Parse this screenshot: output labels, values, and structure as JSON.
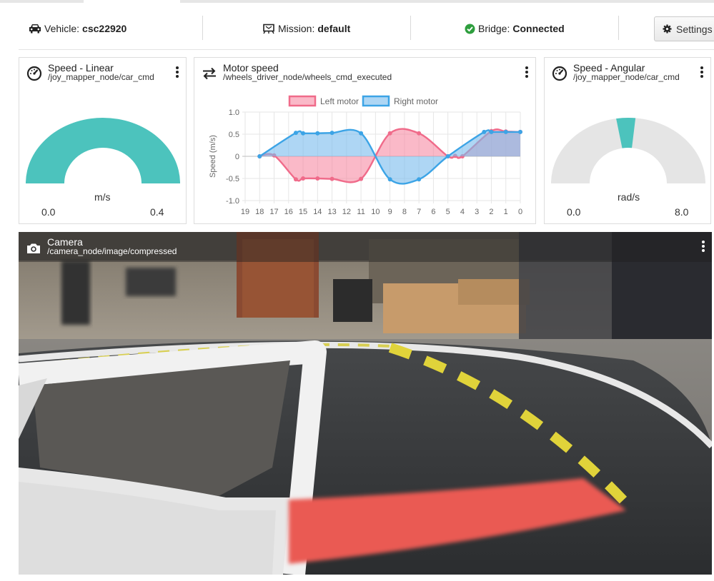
{
  "status": {
    "vehicle_label": "Vehicle:",
    "vehicle_value": "csc22920",
    "mission_label": "Mission:",
    "mission_value": "default",
    "bridge_label": "Bridge:",
    "bridge_value": "Connected",
    "settings_label": "Settings",
    "colors": {
      "connected": "#2e9e3e"
    }
  },
  "panels": {
    "linear": {
      "title": "Speed - Linear",
      "topic": "/joy_mapper_node/car_cmd",
      "icon": "speedometer-icon",
      "unit": "m/s",
      "min": "0.0",
      "max": "0.4",
      "level": 1.0,
      "color": "#4cc3bd"
    },
    "motor": {
      "title": "Motor speed",
      "topic": "/wheels_driver_node/wheels_cmd_executed",
      "icon": "swap-arrows-icon"
    },
    "angular": {
      "title": "Speed - Angular",
      "topic": "/joy_mapper_node/car_cmd",
      "icon": "speedometer-icon",
      "unit": "rad/s",
      "min": "0.0",
      "max": "8.0",
      "value_fraction_start": 0.45,
      "value_fraction_end": 0.53,
      "color": "#4cc3bd",
      "track_color": "#e5e5e5"
    },
    "camera": {
      "title": "Camera",
      "topic": "/camera_node/image/compressed",
      "icon": "camera-icon"
    }
  },
  "chart_data": {
    "type": "line",
    "ylabel": "Speed (m/s)",
    "xlabel": "",
    "ylim": [
      -1.0,
      1.0
    ],
    "yticks": [
      "1.0",
      "0.5",
      "0",
      "-0.5",
      "-1.0"
    ],
    "x": [
      19,
      18,
      17,
      16,
      15,
      14,
      13,
      12,
      11,
      10,
      9,
      8,
      7,
      6,
      5,
      4,
      3,
      2,
      1,
      0
    ],
    "grid": true,
    "legend_position": "top",
    "series": [
      {
        "name": "Left motor",
        "color": "#f06b8a",
        "fill": "rgba(246,128,155,0.55)",
        "values": [
          null,
          0.0,
          0.02,
          null,
          -0.52,
          -0.5,
          -0.51,
          null,
          -0.52,
          null,
          0.52,
          null,
          0.52,
          null,
          0.0,
          0.0,
          null,
          0.57,
          0.56,
          0.55
        ],
        "points": [
          [
            18,
            0.0
          ],
          [
            17,
            0.02
          ],
          [
            15.5,
            -0.52
          ],
          [
            15,
            -0.5
          ],
          [
            14,
            -0.5
          ],
          [
            13,
            -0.51
          ],
          [
            11,
            -0.51
          ],
          [
            9,
            0.52
          ],
          [
            7,
            0.52
          ],
          [
            5,
            0.0
          ],
          [
            4,
            0.0
          ],
          [
            4.5,
            0.01
          ],
          [
            2,
            0.57
          ],
          [
            1,
            0.56
          ],
          [
            0,
            0.55
          ]
        ]
      },
      {
        "name": "Right motor",
        "color": "#3ca4e6",
        "fill": "rgba(120,187,236,0.6)",
        "values": [
          null,
          0.0,
          -0.02,
          null,
          0.53,
          0.52,
          0.53,
          null,
          0.52,
          null,
          -0.52,
          null,
          -0.52,
          null,
          0.0,
          0.0,
          null,
          0.55,
          0.55,
          0.55
        ],
        "points": [
          [
            18,
            0.0
          ],
          [
            15.5,
            0.53
          ],
          [
            15,
            0.52
          ],
          [
            14,
            0.52
          ],
          [
            13,
            0.53
          ],
          [
            11,
            0.52
          ],
          [
            9,
            -0.52
          ],
          [
            7,
            -0.52
          ],
          [
            5,
            0.0
          ],
          [
            2.5,
            0.55
          ],
          [
            2,
            0.55
          ],
          [
            1,
            0.55
          ],
          [
            0,
            0.55
          ]
        ]
      }
    ]
  }
}
